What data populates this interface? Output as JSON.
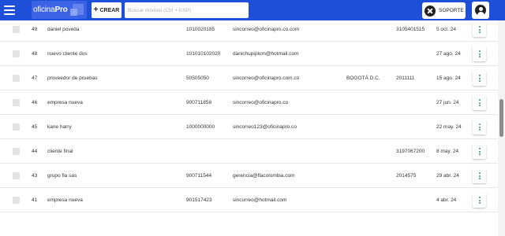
{
  "header": {
    "logo_text_a": "oficina",
    "logo_text_b": "Pro",
    "create_label": "CREAR",
    "search_placeholder": "Buscar módulo (Ctrl + ESP)",
    "support_label": "SOPORTE",
    "icons": {
      "menu": "hamburger-menu-icon",
      "create": "plus-icon",
      "support": "close-circle-icon",
      "user": "user-circle-icon",
      "row_actions": "more-vertical-icon"
    }
  },
  "rows": [
    {
      "id": "49",
      "name": "daniel poveda",
      "doc": "1010020185",
      "email": "sincorreo@oficinapro.co.com",
      "city": "",
      "phone": "3105401515",
      "date": "5 oct. 24"
    },
    {
      "id": "48",
      "name": "nuevo cliente dos",
      "doc": "101010102020",
      "email": "danichupiplum@hotmail.com",
      "city": "",
      "phone": "",
      "date": "27 ago. 24"
    },
    {
      "id": "47",
      "name": "proveedor de pruebas",
      "doc": "50505050",
      "email": "sincorreo@oficinapro.com.co",
      "city": "BOGOTÁ D.C.",
      "phone": "2011111",
      "date": "15 ago. 24"
    },
    {
      "id": "46",
      "name": "empresa nueva",
      "doc": "900711858",
      "email": "sincorreo@oficinapro.co",
      "city": "",
      "phone": "",
      "date": "27 jun. 24"
    },
    {
      "id": "45",
      "name": "kane harry",
      "doc": "1000000000",
      "email": "sincorreo123@oficinapro.co",
      "city": "",
      "phone": "",
      "date": "22 may. 24"
    },
    {
      "id": "44",
      "name": "cliente final",
      "doc": "",
      "email": "",
      "city": "",
      "phone": "3197067200",
      "date": "8 may. 24"
    },
    {
      "id": "43",
      "name": "grupo fla sas",
      "doc": "900711544",
      "email": "gerencia@flacolombia.com",
      "city": "",
      "phone": "2014575",
      "date": "29 abr. 24"
    },
    {
      "id": "41",
      "name": "empresa nueva",
      "doc": "901517423",
      "email": "sincorreo@hotmail.com",
      "city": "",
      "phone": "",
      "date": "4 abr. 24"
    }
  ]
}
